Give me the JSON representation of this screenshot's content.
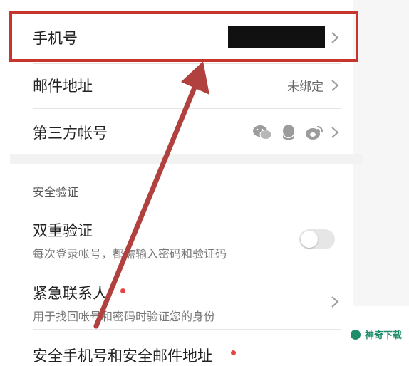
{
  "account_list": {
    "phone": {
      "label": "手机号"
    },
    "email": {
      "label": "邮件地址",
      "value": "未绑定"
    },
    "third_party": {
      "label": "第三方帐号",
      "icons": [
        "wechat-icon",
        "qq-icon",
        "weibo-icon"
      ]
    }
  },
  "security": {
    "header": "安全验证",
    "two_factor": {
      "title": "双重验证",
      "desc": "每次登录帐号，都需输入密码和验证码",
      "enabled": false
    },
    "emergency_contact": {
      "title": "紧急联系人",
      "desc": "用于找回帐号和密码时验证您的身份"
    },
    "next_item_partial": {
      "title": "安全手机号和安全邮件地址"
    }
  },
  "watermark": {
    "text": "神奇下载"
  },
  "colors": {
    "highlight": "#c8352f",
    "dot": "#e64545",
    "accent": "#1e8c6a"
  }
}
